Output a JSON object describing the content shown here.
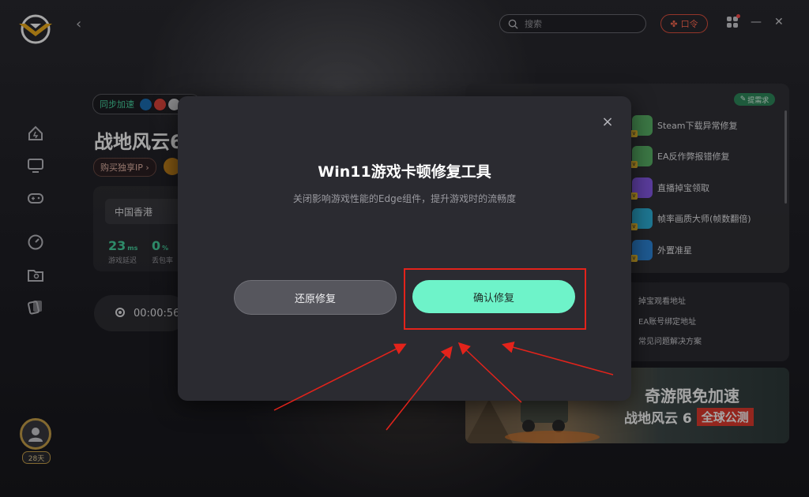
{
  "header": {
    "search_placeholder": "搜索",
    "code_label": "口令",
    "min_symbol": "—",
    "close_symbol": "✕",
    "back_symbol": "‹"
  },
  "sidebar": {
    "items": [
      {
        "icon": "home-icon"
      },
      {
        "icon": "monitor-icon"
      },
      {
        "icon": "gamepad-icon"
      },
      {
        "icon": "speedometer-icon"
      },
      {
        "icon": "folder-icon"
      },
      {
        "icon": "cards-icon"
      }
    ],
    "avatar_days": "28天"
  },
  "game": {
    "sync_label": "同步加速",
    "title": "战地风云6",
    "buy_ip_label": "购买独享IP ›",
    "region": "中国香港",
    "latency_value": "23",
    "latency_unit": "ms",
    "latency_label": "游戏延迟",
    "loss_value": "0",
    "loss_unit": "%",
    "loss_label": "丢包率",
    "timer": "00:00:56"
  },
  "tools": {
    "need_label": "提需求",
    "items": [
      {
        "label": "Steam下载异常修复",
        "color": "#5cb86a"
      },
      {
        "label": "EA反作弊报错修复",
        "color": "#5cb86a"
      },
      {
        "label": "直播掉宝领取",
        "color": "#8a5cf0"
      },
      {
        "label": "帧率画质大师(帧数翻倍)",
        "color": "#2fb7e0"
      },
      {
        "label": "外置准星",
        "color": "#2f8ae0"
      }
    ]
  },
  "links": [
    "掉宝观看地址",
    "EA账号绑定地址",
    "常见问题解决方案"
  ],
  "banner": {
    "line1": "奇游限免加速",
    "line2": "战地风云 6",
    "tag": "全球公测"
  },
  "modal": {
    "title": "Win11游戏卡顿修复工具",
    "description": "关闭影响游戏性能的Edge组件，提升游戏时的流畅度",
    "restore_label": "还原修复",
    "confirm_label": "确认修复",
    "close_symbol": "×"
  },
  "colors": {
    "accent": "#6ef3c9",
    "highlight": "#e3231b",
    "stat_green": "#48d6a2"
  }
}
